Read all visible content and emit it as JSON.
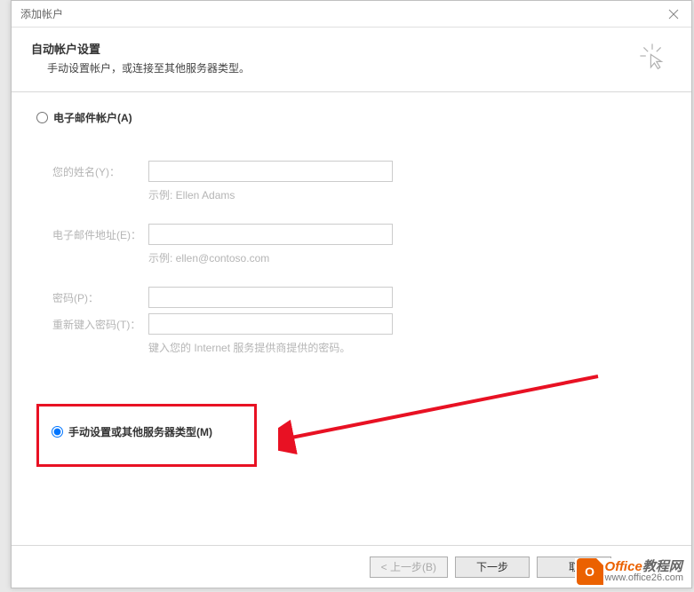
{
  "titlebar": {
    "title": "添加帐户"
  },
  "header": {
    "title": "自动帐户设置",
    "subtitle": "手动设置帐户，或连接至其他服务器类型。"
  },
  "options": {
    "email_account": "电子邮件帐户(A)",
    "manual": "手动设置或其他服务器类型(M)"
  },
  "form": {
    "name_label": "您的姓名(Y)：",
    "name_hint": "示例: Ellen Adams",
    "email_label": "电子邮件地址(E)：",
    "email_hint": "示例: ellen@contoso.com",
    "password_label": "密码(P)：",
    "retype_label": "重新键入密码(T)：",
    "password_hint": "键入您的 Internet 服务提供商提供的密码。"
  },
  "buttons": {
    "back": "< 上一步(B)",
    "next": "下一步",
    "cancel": "取"
  },
  "watermark": {
    "brand_orange": "Office",
    "brand_gray": "教程网",
    "url": "www.office26.com",
    "logo_letter": "O"
  }
}
